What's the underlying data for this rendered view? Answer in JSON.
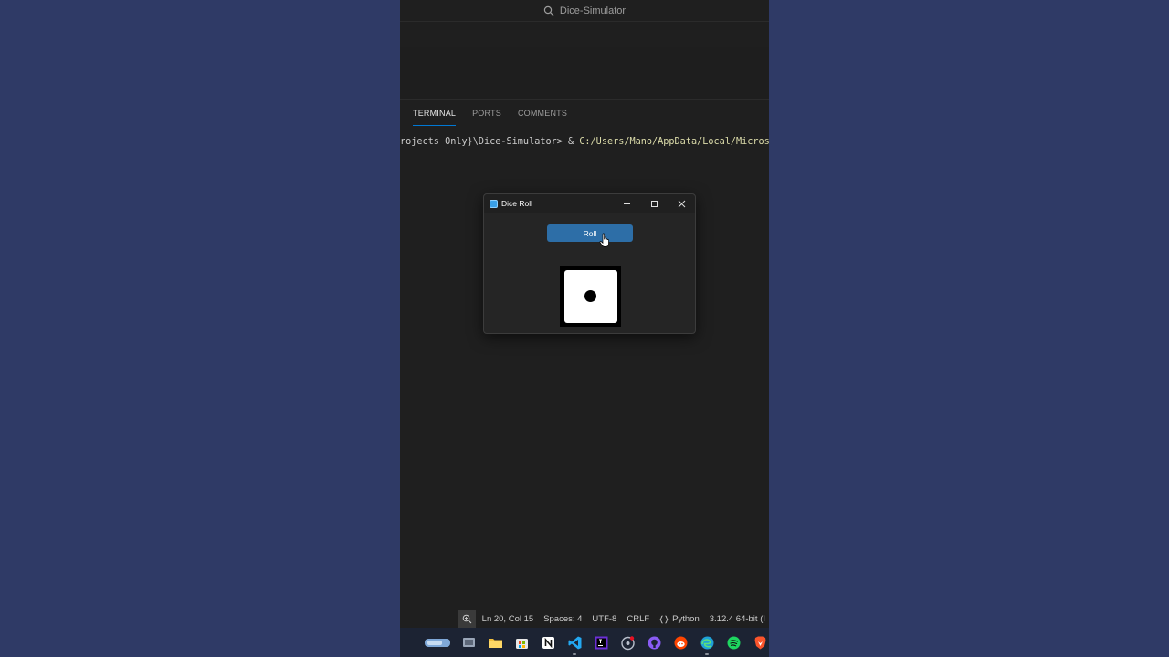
{
  "titlebar": {
    "search_text": "Dice-Simulator"
  },
  "panel": {
    "tabs": [
      {
        "label": "TERMINAL",
        "active": true
      },
      {
        "label": "PORTS",
        "active": false
      },
      {
        "label": "COMMENTS",
        "active": false
      }
    ]
  },
  "terminal": {
    "prompt": "rojects Only}\\Dice-Simulator> & ",
    "path": "C:/Users/Mano/AppData/Local/Microsof"
  },
  "dice_window": {
    "title": "Dice Roll",
    "roll_label": "Roll",
    "die_value": 1
  },
  "statusbar": {
    "position": "Ln 20, Col 15",
    "spaces": "Spaces: 4",
    "encoding": "UTF-8",
    "eol": "CRLF",
    "language": "Python",
    "interpreter": "3.12.4 64-bit (I"
  },
  "taskbar": {
    "icons": [
      "search-taskbar-icon",
      "task-view-icon",
      "file-explorer-icon",
      "store-icon",
      "notion-icon",
      "vscode-icon",
      "jetbrains-icon",
      "github-desktop-icon",
      "github-icon",
      "reddit-icon",
      "edge-icon",
      "spotify-icon",
      "brave-icon"
    ]
  },
  "colors": {
    "accent": "#0078d4",
    "roll_button": "#2d6ea7",
    "background": "#2e3a63"
  }
}
